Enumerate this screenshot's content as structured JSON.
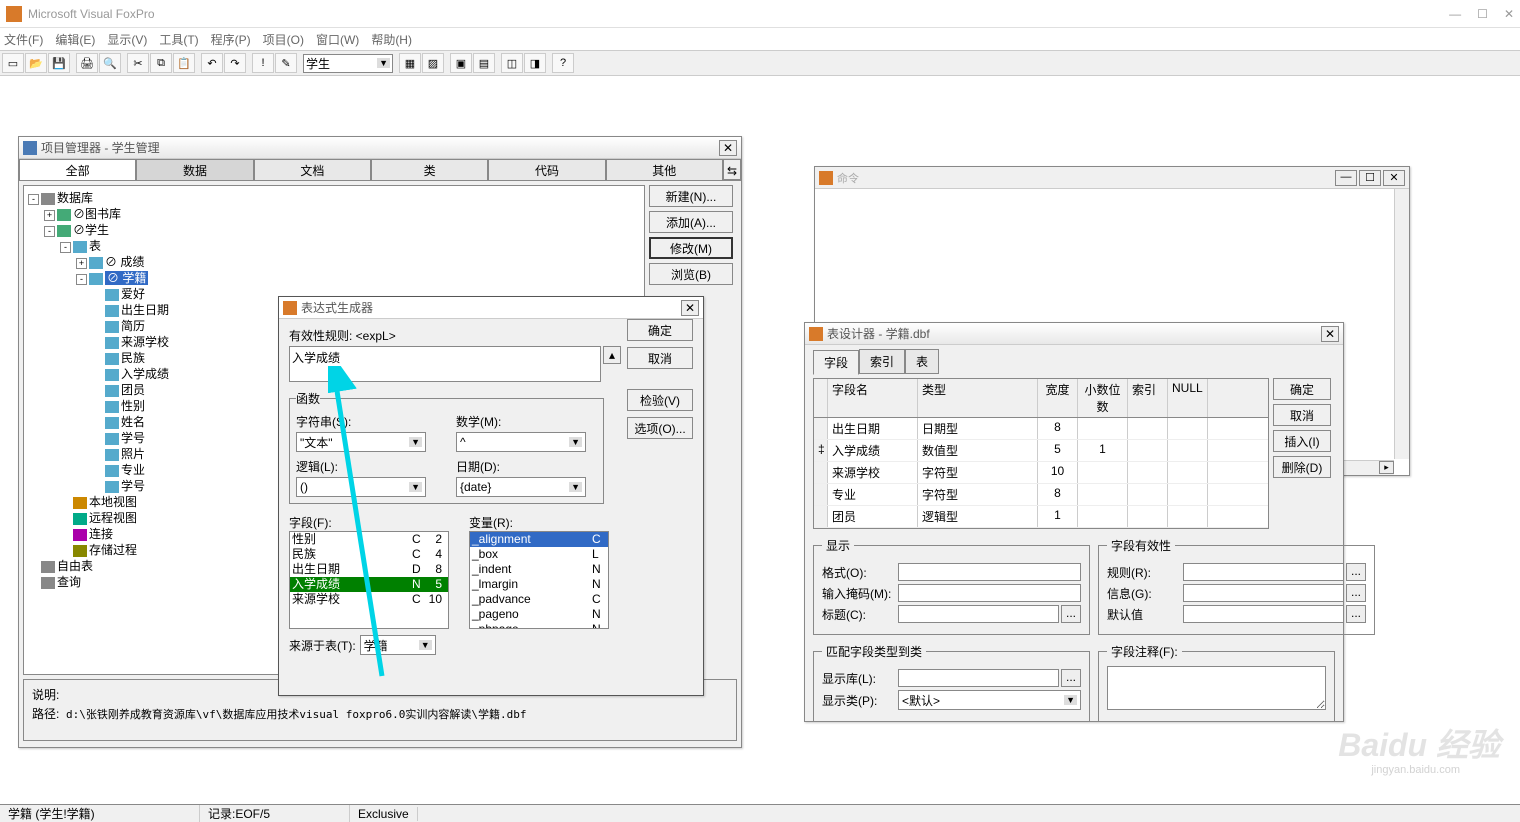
{
  "app": {
    "title": "Microsoft Visual FoxPro"
  },
  "menu": [
    "文件(F)",
    "编辑(E)",
    "显示(V)",
    "工具(T)",
    "程序(P)",
    "项目(O)",
    "窗口(W)",
    "帮助(H)"
  ],
  "toolbarCombo": "学生",
  "pm": {
    "title": "项目管理器 - 学生管理",
    "tabs": [
      "全部",
      "数据",
      "文档",
      "类",
      "代码",
      "其他"
    ],
    "activeTab": 0,
    "buttons": [
      "新建(N)...",
      "添加(A)...",
      "修改(M)",
      "浏览(B)"
    ],
    "tree": [
      {
        "indent": 0,
        "toggle": "-",
        "icon": "db",
        "label": "数据库"
      },
      {
        "indent": 1,
        "toggle": "+",
        "icon": "db2",
        "label": "⊘图书库"
      },
      {
        "indent": 1,
        "toggle": "-",
        "icon": "db2",
        "label": "⊘学生"
      },
      {
        "indent": 2,
        "toggle": "-",
        "icon": "tbl",
        "label": "表"
      },
      {
        "indent": 3,
        "toggle": "+",
        "icon": "tbl2",
        "label": "⊘ 成绩"
      },
      {
        "indent": 3,
        "toggle": "-",
        "icon": "tbl2",
        "label": "⊘ 学籍",
        "selected": true
      },
      {
        "indent": 4,
        "toggle": "",
        "icon": "fld",
        "label": "爱好"
      },
      {
        "indent": 4,
        "toggle": "",
        "icon": "fld",
        "label": "出生日期"
      },
      {
        "indent": 4,
        "toggle": "",
        "icon": "fld",
        "label": "简历"
      },
      {
        "indent": 4,
        "toggle": "",
        "icon": "fld",
        "label": "来源学校"
      },
      {
        "indent": 4,
        "toggle": "",
        "icon": "fld",
        "label": "民族"
      },
      {
        "indent": 4,
        "toggle": "",
        "icon": "fld",
        "label": "入学成绩"
      },
      {
        "indent": 4,
        "toggle": "",
        "icon": "fld",
        "label": "团员"
      },
      {
        "indent": 4,
        "toggle": "",
        "icon": "fld",
        "label": "性别"
      },
      {
        "indent": 4,
        "toggle": "",
        "icon": "fld",
        "label": "姓名"
      },
      {
        "indent": 4,
        "toggle": "",
        "icon": "fld",
        "label": "学号"
      },
      {
        "indent": 4,
        "toggle": "",
        "icon": "fld",
        "label": "照片"
      },
      {
        "indent": 4,
        "toggle": "",
        "icon": "fld",
        "label": "专业"
      },
      {
        "indent": 4,
        "toggle": "",
        "icon": "fld",
        "label": "学号"
      },
      {
        "indent": 2,
        "toggle": "",
        "icon": "lv",
        "label": "本地视图"
      },
      {
        "indent": 2,
        "toggle": "",
        "icon": "rv",
        "label": "远程视图"
      },
      {
        "indent": 2,
        "toggle": "",
        "icon": "cn",
        "label": "连接"
      },
      {
        "indent": 2,
        "toggle": "",
        "icon": "sp",
        "label": "存储过程"
      },
      {
        "indent": 0,
        "toggle": "",
        "icon": "ft",
        "label": "自由表"
      },
      {
        "indent": 0,
        "toggle": "",
        "icon": "qr",
        "label": "查询"
      }
    ],
    "footer": {
      "descLabel": "说明:",
      "pathLabel": "路径:",
      "path": "d:\\张铁刚养成教育资源库\\vf\\数据库应用技术visual foxpro6.0实训内容解读\\学籍.dbf"
    }
  },
  "eb": {
    "title": "表达式生成器",
    "ruleLabel": "有效性规则: <expL>",
    "expr": "入学成绩",
    "buttons": {
      "ok": "确定",
      "cancel": "取消",
      "verify": "检验(V)",
      "options": "选项(O)..."
    },
    "funcGroup": "函数",
    "strLabel": "字符串(S):",
    "strVal": "\"文本\"",
    "mathLabel": "数学(M):",
    "mathVal": "^",
    "logicLabel": "逻辑(L):",
    "logicVal": "()",
    "dateLabel": "日期(D):",
    "dateVal": "{date}",
    "fieldLabel": "字段(F):",
    "varLabel": "变量(R):",
    "fromLabel": "来源于表(T):",
    "fromVal": "学籍",
    "fields": [
      {
        "name": "性别",
        "type": "C",
        "len": "2"
      },
      {
        "name": "民族",
        "type": "C",
        "len": "4"
      },
      {
        "name": "出生日期",
        "type": "D",
        "len": "8"
      },
      {
        "name": "入学成绩",
        "type": "N",
        "len": "5",
        "sel": true
      },
      {
        "name": "来源学校",
        "type": "C",
        "len": "10"
      }
    ],
    "vars": [
      {
        "name": "_alignment",
        "type": "C",
        "hl": true
      },
      {
        "name": "_box",
        "type": "L"
      },
      {
        "name": "_indent",
        "type": "N"
      },
      {
        "name": "_lmargin",
        "type": "N"
      },
      {
        "name": "_padvance",
        "type": "C"
      },
      {
        "name": "_pageno",
        "type": "N"
      },
      {
        "name": "_pbpage",
        "type": "N"
      }
    ]
  },
  "cmd": {
    "title": "命令"
  },
  "td": {
    "title": "表设计器 - 学籍.dbf",
    "tabs": [
      "字段",
      "索引",
      "表"
    ],
    "cols": {
      "name": "字段名",
      "type": "类型",
      "width": "宽度",
      "dec": "小数位数",
      "idx": "索引",
      "null": "NULL"
    },
    "rows": [
      {
        "name": "出生日期",
        "type": "日期型",
        "width": "8",
        "dec": ""
      },
      {
        "name": "入学成绩",
        "type": "数值型",
        "width": "5",
        "dec": "1"
      },
      {
        "name": "来源学校",
        "type": "字符型",
        "width": "10",
        "dec": ""
      },
      {
        "name": "专业",
        "type": "字符型",
        "width": "8",
        "dec": ""
      },
      {
        "name": "团员",
        "type": "逻辑型",
        "width": "1",
        "dec": ""
      }
    ],
    "sideButtons": [
      "确定",
      "取消",
      "插入(I)",
      "删除(D)"
    ],
    "display": {
      "legend": "显示",
      "format": "格式(O):",
      "mask": "输入掩码(M):",
      "caption": "标题(C):"
    },
    "valid": {
      "legend": "字段有效性",
      "rule": "规则(R):",
      "msg": "信息(G):",
      "default": "默认值"
    },
    "match": {
      "legend": "匹配字段类型到类",
      "lib": "显示库(L):",
      "cls": "显示类(P):",
      "clsVal": "<默认>"
    },
    "comment": {
      "legend": "字段注释(F):"
    }
  },
  "status": {
    "s1": "学籍 (学生!学籍)",
    "s2": "记录:EOF/5",
    "s3": "Exclusive"
  },
  "watermark": "Baidu 经验",
  "watermark2": "jingyan.baidu.com"
}
